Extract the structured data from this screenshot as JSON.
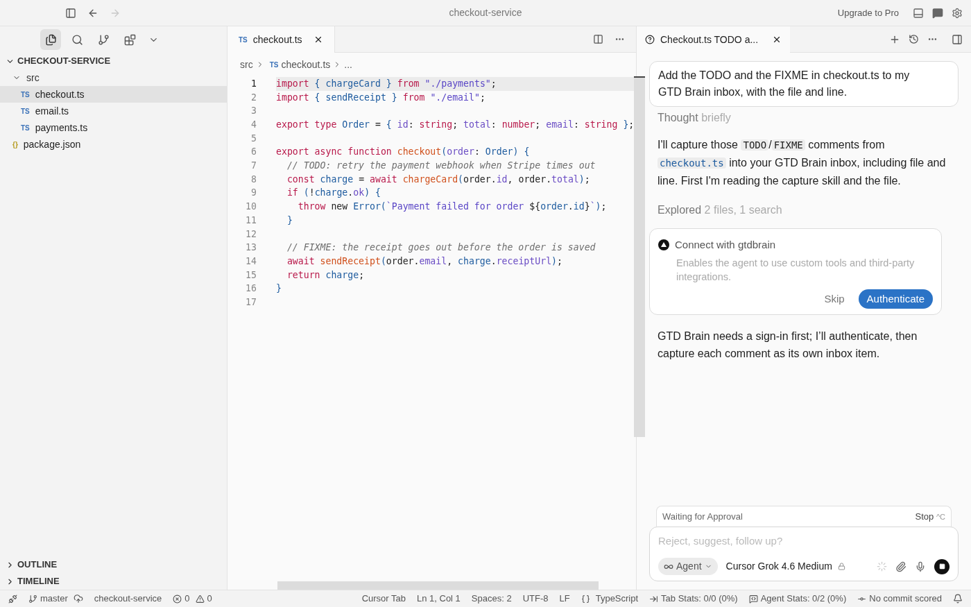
{
  "title_bar": {
    "title": "checkout-service",
    "upgrade": "Upgrade to Pro",
    "forward_disabled": true
  },
  "activity": [
    {
      "selected": true
    },
    {
      "selected": false
    },
    {
      "selected": false
    },
    {
      "selected": false
    }
  ],
  "explorer": {
    "root": {
      "label": "CHECKOUT-SERVICE",
      "expanded": true,
      "children": [
        {
          "label": "src",
          "kind": "folder",
          "expanded": true,
          "children": [
            {
              "label": "checkout.ts",
              "kind": "file",
              "badge": "TS",
              "selected": true
            },
            {
              "label": "email.ts",
              "kind": "file",
              "badge": "TS",
              "selected": false
            },
            {
              "label": "payments.ts",
              "kind": "file",
              "badge": "TS",
              "selected": false
            }
          ]
        },
        {
          "label": "package.json",
          "kind": "file",
          "badge": "{}",
          "selected": false
        }
      ]
    },
    "sections": [
      {
        "label": "OUTLINE",
        "expanded": false
      },
      {
        "label": "TIMELINE",
        "expanded": false
      }
    ]
  },
  "editor": {
    "tabs": [
      {
        "badge": "TS",
        "label": "checkout.ts",
        "selected": true
      }
    ],
    "breadcrumb": {
      "folder": "src",
      "badge": "TS",
      "file": "checkout.ts",
      "more": "..."
    },
    "lines": [
      {
        "number": "1",
        "current": true,
        "text": "import { chargeCard } from \"./payments\";"
      },
      {
        "number": "2",
        "current": false,
        "text": "import { sendReceipt } from \"./email\";"
      },
      {
        "number": "3",
        "current": false
      },
      {
        "number": "4",
        "current": false,
        "text": "export type Order = { id: string; total: number; email: string };"
      },
      {
        "number": "5",
        "current": false
      },
      {
        "number": "6",
        "current": false,
        "text": "export async function checkout(order: Order) {"
      },
      {
        "number": "7",
        "current": false,
        "text": "  // TODO: retry the payment webhook when Stripe times out"
      },
      {
        "number": "8",
        "current": false,
        "text": "  const charge = await chargeCard(order.id, order.total);"
      },
      {
        "number": "9",
        "current": false,
        "text": "  if (!charge.ok) {"
      },
      {
        "number": "10",
        "current": false,
        "text": "    throw new Error(`Payment failed for order ${order.id}`);"
      },
      {
        "number": "11",
        "current": false,
        "text": "  }"
      },
      {
        "number": "12",
        "current": false
      },
      {
        "number": "13",
        "current": false,
        "text": "  // FIXME: the receipt goes out before the order is saved"
      },
      {
        "number": "14",
        "current": false,
        "text": "  await sendReceipt(order.email, charge.receiptUrl);"
      },
      {
        "number": "15",
        "current": false,
        "text": "  return charge;"
      },
      {
        "number": "16",
        "current": false,
        "text": "}"
      },
      {
        "number": "17",
        "current": false
      }
    ]
  },
  "chat": {
    "tab": {
      "label": "Checkout.ts TODO a...",
      "selected": true
    },
    "items": [
      {
        "kind": "user",
        "text": "Add the TODO and the FIXME in checkout.ts to my GTD Brain inbox, with the file and line."
      },
      {
        "kind": "status",
        "label": "Thought",
        "detail": "briefly"
      },
      {
        "kind": "assistant",
        "parts": [
          {
            "kind": "text",
            "text": "I'll capture those "
          },
          {
            "kind": "code",
            "text": "TODO"
          },
          {
            "kind": "text",
            "text": "/"
          },
          {
            "kind": "code",
            "text": "FIXME"
          },
          {
            "kind": "text",
            "text": " comments from "
          },
          {
            "kind": "file",
            "text": "checkout.ts"
          },
          {
            "kind": "text",
            "text": " into your GTD Brain inbox, including file and line. First I'm reading the capture skill and the file."
          }
        ]
      },
      {
        "kind": "status",
        "label": "Explored",
        "detail": "2 files, 1 search"
      },
      {
        "kind": "auth",
        "title": "Connect with gtdbrain",
        "description": "Enables the agent to use custom tools and third-party integrations.",
        "skip": "Skip",
        "confirm": "Authenticate"
      },
      {
        "kind": "assistant",
        "parts": [
          {
            "kind": "text",
            "text": "GTD Brain needs a sign-in first; I’ll authenticate, then capture each comment as its own inbox item."
          }
        ]
      }
    ],
    "approval": {
      "label": "Waiting for Approval",
      "stop": "Stop",
      "shortcut": "^C"
    },
    "composer": {
      "placeholder": "Reject, suggest, follow up?",
      "mode": "Agent",
      "model": "Cursor Grok 4.6 Medium"
    }
  },
  "status_bar": {
    "branch": "master",
    "workspace": "checkout-service",
    "errors": "0",
    "warnings": "0",
    "right": [
      {
        "kind": "plain",
        "text": "Cursor Tab"
      },
      {
        "kind": "plain",
        "text": "Ln 1, Col 1"
      },
      {
        "kind": "plain",
        "text": "Spaces: 2"
      },
      {
        "kind": "plain",
        "text": "UTF-8"
      },
      {
        "kind": "plain",
        "text": "LF"
      },
      {
        "kind": "language",
        "text": "TypeScript"
      },
      {
        "kind": "tab_stats",
        "text": "Tab Stats: 0/0 (0%)"
      },
      {
        "kind": "agent_stats",
        "text": "Agent Stats: 0/2 (0%)"
      },
      {
        "kind": "commit",
        "text": "No commit scored"
      }
    ]
  }
}
